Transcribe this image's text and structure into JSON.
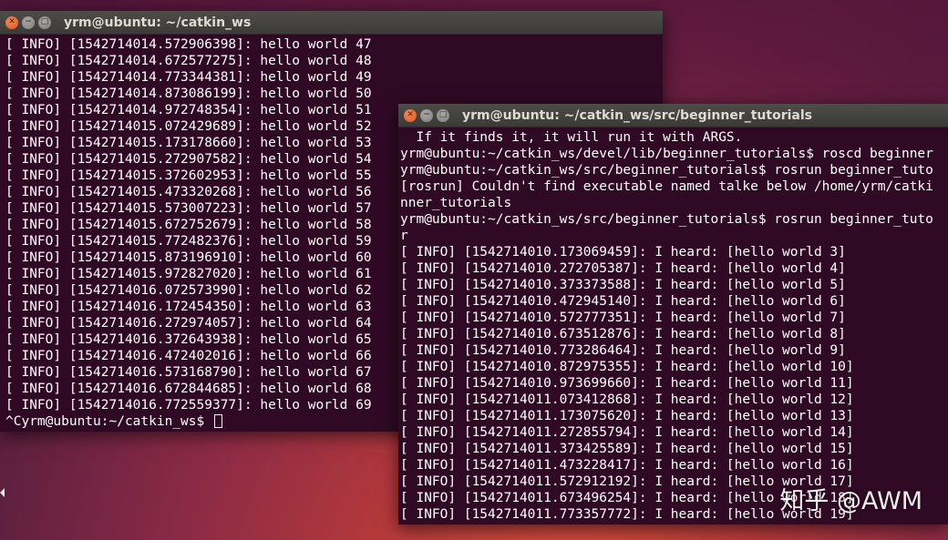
{
  "window1": {
    "title": "yrm@ubuntu: ~/catkin_ws",
    "lines": [
      "[ INFO] [1542714014.572906398]: hello world 47",
      "[ INFO] [1542714014.672577275]: hello world 48",
      "[ INFO] [1542714014.773344381]: hello world 49",
      "[ INFO] [1542714014.873086199]: hello world 50",
      "[ INFO] [1542714014.972748354]: hello world 51",
      "[ INFO] [1542714015.072429689]: hello world 52",
      "[ INFO] [1542714015.173178660]: hello world 53",
      "[ INFO] [1542714015.272907582]: hello world 54",
      "[ INFO] [1542714015.372602953]: hello world 55",
      "[ INFO] [1542714015.473320268]: hello world 56",
      "[ INFO] [1542714015.573007223]: hello world 57",
      "[ INFO] [1542714015.672752679]: hello world 58",
      "[ INFO] [1542714015.772482376]: hello world 59",
      "[ INFO] [1542714015.873196910]: hello world 60",
      "[ INFO] [1542714015.972827020]: hello world 61",
      "[ INFO] [1542714016.072573990]: hello world 62",
      "[ INFO] [1542714016.172454350]: hello world 63",
      "[ INFO] [1542714016.272974057]: hello world 64",
      "[ INFO] [1542714016.372643938]: hello world 65",
      "[ INFO] [1542714016.472402016]: hello world 66",
      "[ INFO] [1542714016.573168790]: hello world 67",
      "[ INFO] [1542714016.672844685]: hello world 68",
      "[ INFO] [1542714016.772559377]: hello world 69"
    ],
    "prompt": "^Cyrm@ubuntu:~/catkin_ws$ "
  },
  "window2": {
    "title": "yrm@ubuntu: ~/catkin_ws/src/beginner_tutorials",
    "lines": [
      "  If it finds it, it will run it with ARGS.",
      "yrm@ubuntu:~/catkin_ws/devel/lib/beginner_tutorials$ roscd beginner",
      "yrm@ubuntu:~/catkin_ws/src/beginner_tutorials$ rosrun beginner_tuto",
      "[rosrun] Couldn't find executable named talke below /home/yrm/catki",
      "nner_tutorials",
      "yrm@ubuntu:~/catkin_ws/src/beginner_tutorials$ rosrun beginner_tuto",
      "r",
      "[ INFO] [1542714010.173069459]: I heard: [hello world 3]",
      "[ INFO] [1542714010.272705387]: I heard: [hello world 4]",
      "[ INFO] [1542714010.373373588]: I heard: [hello world 5]",
      "[ INFO] [1542714010.472945140]: I heard: [hello world 6]",
      "[ INFO] [1542714010.572777351]: I heard: [hello world 7]",
      "[ INFO] [1542714010.673512876]: I heard: [hello world 8]",
      "[ INFO] [1542714010.773286464]: I heard: [hello world 9]",
      "[ INFO] [1542714010.872975355]: I heard: [hello world 10]",
      "[ INFO] [1542714010.973699660]: I heard: [hello world 11]",
      "[ INFO] [1542714011.073412868]: I heard: [hello world 12]",
      "[ INFO] [1542714011.173075620]: I heard: [hello world 13]",
      "[ INFO] [1542714011.272855794]: I heard: [hello world 14]",
      "[ INFO] [1542714011.373425589]: I heard: [hello world 15]",
      "[ INFO] [1542714011.473228417]: I heard: [hello world 16]",
      "[ INFO] [1542714011.572912192]: I heard: [hello world 17]",
      "[ INFO] [1542714011.673496254]: I heard: [hello world 18]",
      "[ INFO] [1542714011.773357772]: I heard: [hello world 19]"
    ]
  },
  "watermark": "知乎 @AWM",
  "colors": {
    "terminal_bg": "#300a24",
    "titlebar_bg": "#3c3b37",
    "close_button": "#e2511c",
    "text": "#ffffff"
  },
  "icons": {
    "close": "close-icon",
    "minimize": "minimize-icon",
    "maximize": "maximize-icon"
  }
}
